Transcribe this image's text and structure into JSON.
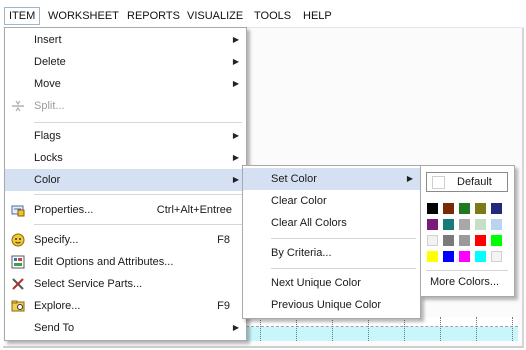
{
  "menubar": {
    "items": [
      {
        "label": "ITEM",
        "active": true
      },
      {
        "label": "WORKSHEET"
      },
      {
        "label": "REPORTS"
      },
      {
        "label": "VISUALIZE"
      },
      {
        "label": "TOOLS"
      },
      {
        "label": "HELP"
      }
    ]
  },
  "item_menu": {
    "insert": "Insert",
    "delete": "Delete",
    "move": "Move",
    "split": "Split...",
    "flags": "Flags",
    "locks": "Locks",
    "color": "Color",
    "properties": "Properties...",
    "properties_shortcut": "Ctrl+Alt+Entree",
    "specify": "Specify...",
    "specify_shortcut": "F8",
    "edit_options": "Edit Options and Attributes...",
    "select_service_parts": "Select Service Parts...",
    "explore": "Explore...",
    "explore_shortcut": "F9",
    "send_to": "Send To"
  },
  "color_menu": {
    "set_color": "Set Color",
    "clear_color": "Clear Color",
    "clear_all_colors": "Clear All Colors",
    "by_criteria": "By Criteria...",
    "next_unique_color": "Next Unique Color",
    "previous_unique_color": "Previous Unique Color"
  },
  "color_panel": {
    "default_label": "Default",
    "more_colors": "More Colors...",
    "swatches": [
      [
        "#000000",
        "#7a2a00",
        "#1f7a1f",
        "#7a7a1a",
        "#1f2a7a"
      ],
      [
        "#7a1a7a",
        "#1a7a7a",
        "#a8a8a8",
        "#c6e0c6",
        "#b9d3f0"
      ],
      [
        "#f2f2f2",
        "#7a7a7a",
        "#9a9a9a",
        "#ff0000",
        "#00ff00"
      ],
      [
        "#ffff00",
        "#0000ff",
        "#ff00ff",
        "#00ffff",
        "#f4f4f4"
      ]
    ]
  },
  "colors": {
    "highlight": "#d5e1f3",
    "menu_border": "#a9a9a9",
    "grid_fill": "#c9f6fb"
  }
}
